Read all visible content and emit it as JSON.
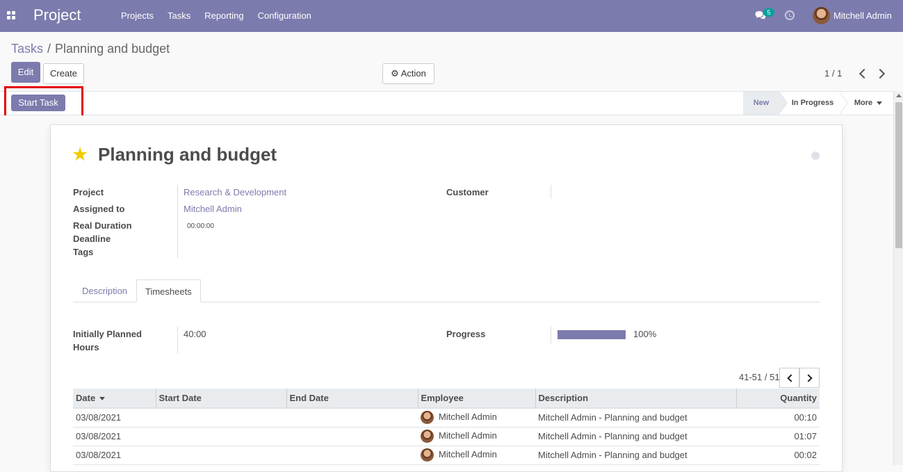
{
  "navbar": {
    "app_title": "Project",
    "menu": [
      "Projects",
      "Tasks",
      "Reporting",
      "Configuration"
    ],
    "messages_badge": "5",
    "user_name": "Mitchell Admin",
    "color": "#7c7bad"
  },
  "breadcrumb": {
    "parent": "Tasks",
    "separator": "/",
    "current": "Planning and budget"
  },
  "buttons": {
    "edit": "Edit",
    "create": "Create",
    "action": "Action",
    "start_task": "Start Task"
  },
  "pager": {
    "value": "1 / 1"
  },
  "stages": {
    "new": "New",
    "in_progress": "In Progress",
    "more": "More"
  },
  "record": {
    "title": "Planning and budget",
    "starred": true,
    "fields": {
      "project_label": "Project",
      "project_value": "Research & Development",
      "assigned_label": "Assigned to",
      "assigned_value": "Mitchell Admin",
      "duration_label": "Real Duration",
      "duration_value": "00:00:00",
      "deadline_label": "Deadline",
      "tags_label": "Tags",
      "customer_label": "Customer"
    }
  },
  "tabs": {
    "description": "Description",
    "timesheets": "Timesheets"
  },
  "timesheets": {
    "planned_label_line1": "Initially Planned",
    "planned_label_line2": "Hours",
    "planned_value": "40:00",
    "progress_label": "Progress",
    "progress_value": "100%",
    "progress_fraction": 1.0,
    "list_pager": "41-51 / 51",
    "columns": [
      "Date",
      "Start Date",
      "End Date",
      "Employee",
      "Description",
      "Quantity"
    ],
    "rows": [
      {
        "date": "03/08/2021",
        "start": "",
        "end": "",
        "employee": "Mitchell Admin",
        "description": "Mitchell Admin - Planning and budget",
        "quantity": "00:10"
      },
      {
        "date": "03/08/2021",
        "start": "",
        "end": "",
        "employee": "Mitchell Admin",
        "description": "Mitchell Admin - Planning and budget",
        "quantity": "01:07"
      },
      {
        "date": "03/08/2021",
        "start": "",
        "end": "",
        "employee": "Mitchell Admin",
        "description": "Mitchell Admin - Planning and budget",
        "quantity": "00:02"
      }
    ]
  },
  "icons": {
    "apps": "apps-grid-icon",
    "chat": "chat-icon",
    "clock": "clock-icon",
    "gear": "gear-icon",
    "star": "star-icon"
  }
}
